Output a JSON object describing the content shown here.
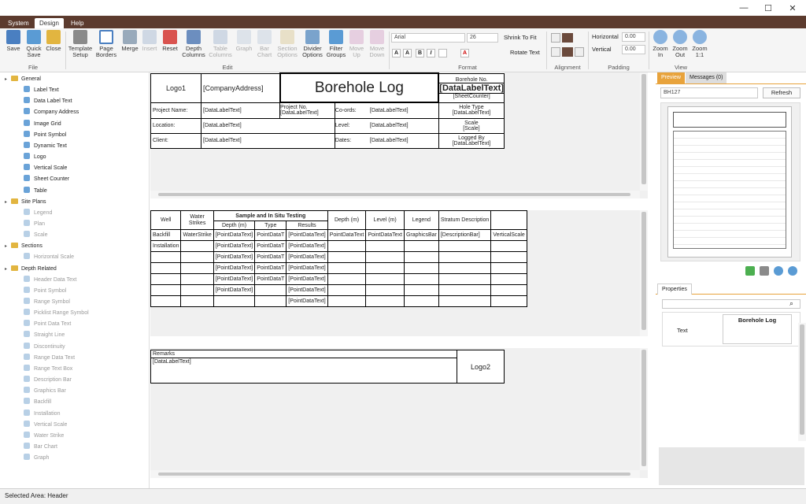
{
  "window": {
    "minimize": "—",
    "maximize": "☐",
    "close": "✕"
  },
  "menu": {
    "tabs": [
      "System",
      "Design",
      "Help"
    ]
  },
  "ribbon": {
    "file": {
      "label": "File",
      "buttons": [
        "Save",
        "Quick Save",
        "Close"
      ]
    },
    "edit": {
      "label": "Edit",
      "buttons": [
        "Template Setup",
        "Page Borders",
        "Merge",
        "Insert",
        "Reset",
        "Depth Columns",
        "Table Columns",
        "Graph",
        "Bar Chart",
        "Section Options",
        "Divider Options",
        "Filter Groups",
        "Move Up",
        "Move Down"
      ]
    },
    "format": {
      "label": "Format",
      "font": "Arial",
      "size": "26",
      "shrink": "Shrink To Fit",
      "rotate": "Rotate Text",
      "grow": "A",
      "shrinkA": "A",
      "bold": "B",
      "italic": "I",
      "fontcolor": "A"
    },
    "alignment": {
      "label": "Alignment"
    },
    "padding": {
      "label": "Padding",
      "horizontal_label": "Horizontal",
      "horizontal_value": "0.00",
      "vertical_label": "Vertical",
      "vertical_value": "0.00"
    },
    "view": {
      "label": "View",
      "buttons": [
        "Zoom In",
        "Zoom Out",
        "Zoom 1:1"
      ]
    }
  },
  "tree": [
    {
      "label": "General",
      "type": "folder",
      "level": 0
    },
    {
      "label": "Label Text",
      "type": "item",
      "level": 1
    },
    {
      "label": "Data Label Text",
      "type": "item",
      "level": 1
    },
    {
      "label": "Company Address",
      "type": "item",
      "level": 1
    },
    {
      "label": "Image Grid",
      "type": "item",
      "level": 1
    },
    {
      "label": "Point Symbol",
      "type": "item",
      "level": 1
    },
    {
      "label": "Dynamic Text",
      "type": "item",
      "level": 1
    },
    {
      "label": "Logo",
      "type": "item",
      "level": 1
    },
    {
      "label": "Vertical Scale",
      "type": "item",
      "level": 1
    },
    {
      "label": "Sheet Counter",
      "type": "item",
      "level": 1
    },
    {
      "label": "Table",
      "type": "item",
      "level": 1
    },
    {
      "label": "Site Plans",
      "type": "folder",
      "level": 0
    },
    {
      "label": "Legend",
      "type": "dis",
      "level": 1
    },
    {
      "label": "Plan",
      "type": "dis",
      "level": 1
    },
    {
      "label": "Scale",
      "type": "dis",
      "level": 1
    },
    {
      "label": "Sections",
      "type": "folder",
      "level": 0
    },
    {
      "label": "Horizontal Scale",
      "type": "dis",
      "level": 1
    },
    {
      "label": "Depth Related",
      "type": "folder",
      "level": 0
    },
    {
      "label": "Header Data Text",
      "type": "dis",
      "level": 1
    },
    {
      "label": "Point Symbol",
      "type": "dis",
      "level": 1
    },
    {
      "label": "Range Symbol",
      "type": "dis",
      "level": 1
    },
    {
      "label": "Picklist Range Symbol",
      "type": "dis",
      "level": 1
    },
    {
      "label": "Point Data Text",
      "type": "dis",
      "level": 1
    },
    {
      "label": "Straight Line",
      "type": "dis",
      "level": 1
    },
    {
      "label": "Discontinuity",
      "type": "dis",
      "level": 1
    },
    {
      "label": "Range Data Text",
      "type": "dis",
      "level": 1
    },
    {
      "label": "Range Text Box",
      "type": "dis",
      "level": 1
    },
    {
      "label": "Description Bar",
      "type": "dis",
      "level": 1
    },
    {
      "label": "Graphics Bar",
      "type": "dis",
      "level": 1
    },
    {
      "label": "Backfill",
      "type": "dis",
      "level": 1
    },
    {
      "label": "Installation",
      "type": "dis",
      "level": 1
    },
    {
      "label": "Vertical Scale",
      "type": "dis",
      "level": 1
    },
    {
      "label": "Water Strike",
      "type": "dis",
      "level": 1
    },
    {
      "label": "Bar Chart",
      "type": "dis",
      "level": 1
    },
    {
      "label": "Graph",
      "type": "dis",
      "level": 1
    }
  ],
  "header": {
    "logo1": "Logo1",
    "company": "[CompanyAddress]",
    "title": "Borehole Log",
    "borehole_no": "Borehole No.",
    "datalabel_big": "[DataLabelText]",
    "sheet_counter": "[SheetCounter]",
    "project_name": "Project Name:",
    "project_no": "Project No.",
    "coords": "Co-ords:",
    "hole_type": "Hole Type",
    "location": "Location:",
    "level": "Level:",
    "scale": "Scale",
    "scale_val": "[Scale]",
    "client": "Client:",
    "dates": "Dates:",
    "logged_by": "Logged By",
    "dlt": "[DataLabelText]"
  },
  "body": {
    "well": "Well",
    "water": "Water Strikes",
    "sample": "Sample and In Situ Testing",
    "depth_m": "Depth (m)",
    "type": "Type",
    "results": "Results",
    "depth": "Depth (m)",
    "levelm": "Level (m)",
    "legend": "Legend",
    "stratum": "Stratum Description",
    "r1": [
      "Backfill",
      "WaterStrike",
      "[PointDataText]",
      "PointDataT",
      "[PointDataText]",
      "PointDataText",
      "PointDataText",
      "GraphicsBar",
      "[DescriptionBar]",
      "VerticalScale"
    ],
    "r2c0": "Installation",
    "pdt": "[PointDataText]",
    "pdt_short": "PointDataT"
  },
  "footer": {
    "remarks": "Remarks",
    "dlt": "[DataLabelText]",
    "logo2": "Logo2"
  },
  "right": {
    "tab_preview": "Preview",
    "tab_messages": "Messages (0)",
    "select": "BH127",
    "refresh": "Refresh",
    "properties": "Properties",
    "prop_name": "Text",
    "prop_value": "Borehole Log"
  },
  "status": "Selected Area: Header",
  "colors": {
    "menubar": "#5c3b2e",
    "accent": "#e8a33c"
  }
}
